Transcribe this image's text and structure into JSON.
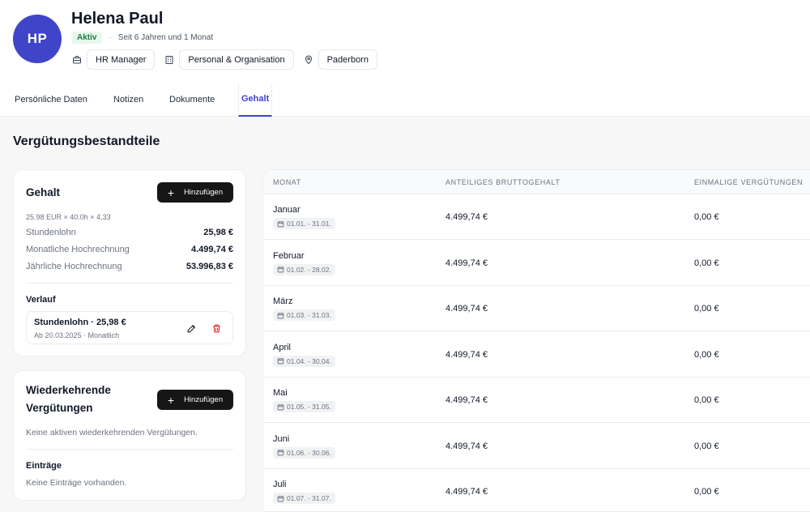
{
  "profile": {
    "initials": "HP",
    "name": "Helena Paul",
    "status": "Aktiv",
    "tenure": "Seit 6 Jahren und 1 Monat",
    "chips": [
      {
        "icon": "briefcase-icon",
        "label": "HR Manager"
      },
      {
        "icon": "building-icon",
        "label": "Personal & Organisation"
      },
      {
        "icon": "location-pin-icon",
        "label": "Paderborn"
      }
    ]
  },
  "tabs": [
    {
      "label": "Persönliche Daten",
      "active": false
    },
    {
      "label": "Notizen",
      "active": false
    },
    {
      "label": "Dokumente",
      "active": false
    },
    {
      "label": "Gehalt",
      "active": true
    }
  ],
  "section_title": "Vergütungsbestandteile",
  "salary_card": {
    "title": "Gehalt",
    "add_label": "Hinzufügen",
    "formula": "25.98 EUR × 40.0h × 4,33",
    "rows": [
      {
        "label": "Stundenlohn",
        "value": "25,98 €"
      },
      {
        "label": "Monatliche Hochrechnung",
        "value": "4.499,74 €"
      },
      {
        "label": "Jährliche Hochrechnung",
        "value": "53.996,83 €"
      }
    ],
    "history_title": "Verlauf",
    "history": {
      "main": "Stundenlohn · 25,98 €",
      "sub": "Ab 20.03.2025 · Monatlich"
    }
  },
  "recurring_card": {
    "title_line1": "Wiederkehrende",
    "title_line2": "Vergütungen",
    "add_label": "Hinzufügen",
    "empty_text": "Keine aktiven wiederkehrenden Vergütungen.",
    "entries_title": "Einträge",
    "entries_empty": "Keine Einträge vorhanden."
  },
  "table": {
    "columns": [
      "MONAT",
      "ANTEILIGES BRUTTOGEHALT",
      "EINMALIGE VERGÜTUNGEN"
    ],
    "rows": [
      {
        "month": "Januar",
        "range": "01.01. - 31.01.",
        "gross": "4.499,74 €",
        "onetime": "0,00 €"
      },
      {
        "month": "Februar",
        "range": "01.02. - 28.02.",
        "gross": "4.499,74 €",
        "onetime": "0,00 €"
      },
      {
        "month": "März",
        "range": "01.03. - 31.03.",
        "gross": "4.499,74 €",
        "onetime": "0,00 €"
      },
      {
        "month": "April",
        "range": "01.04. - 30.04.",
        "gross": "4.499,74 €",
        "onetime": "0,00 €"
      },
      {
        "month": "Mai",
        "range": "01.05. - 31.05.",
        "gross": "4.499,74 €",
        "onetime": "0,00 €"
      },
      {
        "month": "Juni",
        "range": "01.06. - 30.06.",
        "gross": "4.499,74 €",
        "onetime": "0,00 €"
      },
      {
        "month": "Juli",
        "range": "01.07. - 31.07.",
        "gross": "4.499,74 €",
        "onetime": "0,00 €"
      }
    ]
  },
  "colors": {
    "accent": "#3f44c9",
    "badge_bg": "#e7f7ec",
    "badge_text": "#15803d",
    "delete": "#dc2626"
  }
}
